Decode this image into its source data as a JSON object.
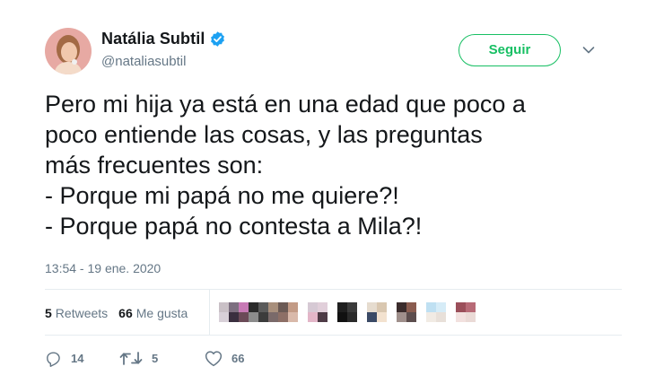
{
  "user": {
    "display_name": "Natália Subtil",
    "handle": "@nataliasubtil",
    "verified": true
  },
  "follow_button": {
    "label": "Seguir"
  },
  "tweet": {
    "text": "Pero mi hija ya está en una edad que poco a\npoco entiende las cosas, y las preguntas\nmás frecuentes son:\n- Porque mi papá no me quiere?!\n- Porque papá no contesta a Mila?!",
    "timestamp": "13:54 - 19 ene. 2020"
  },
  "stats": {
    "retweets_count": "5",
    "retweets_label": "Retweets",
    "likes_count": "66",
    "likes_label": "Me gusta"
  },
  "actions": {
    "reply_count": "14",
    "retweet_count": "5",
    "like_count": "66"
  },
  "icons": {
    "verified": "verified-badge-icon",
    "caret": "chevron-down-icon",
    "reply": "reply-icon",
    "retweet": "retweet-icon",
    "like": "heart-icon"
  },
  "colors": {
    "accent_green": "#17bf63",
    "verified_blue": "#1da1f2",
    "secondary_text": "#657786",
    "primary_text": "#14171a"
  }
}
